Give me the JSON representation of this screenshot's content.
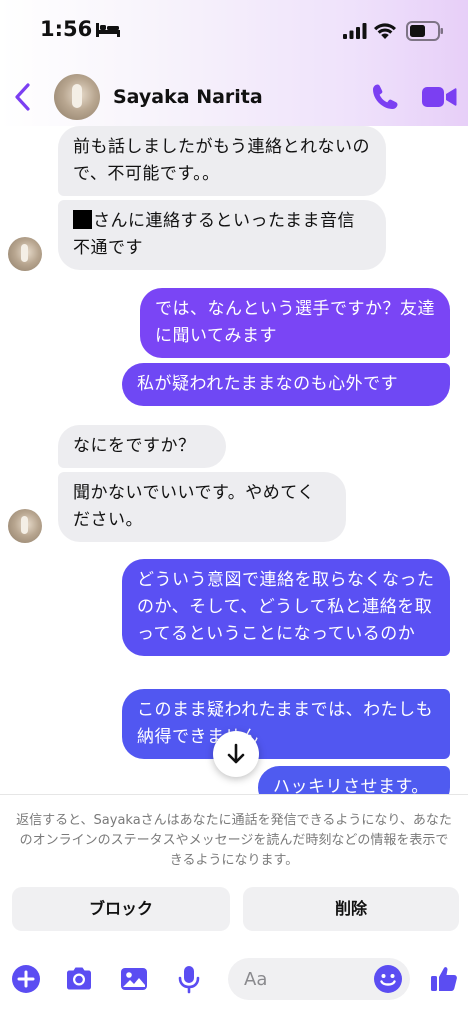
{
  "status_bar": {
    "time": "1:56"
  },
  "header": {
    "contact_name": "Sayaka Narita"
  },
  "messages": [
    {
      "side": "in",
      "text": "前も話しましたがもう連絡とれないので、不可能です。。"
    },
    {
      "side": "in",
      "text_after_redaction": "さんに連絡するといったまま音信不通です"
    },
    {
      "side": "out",
      "text": "では、なんという選手ですか？友達に聞いてみます"
    },
    {
      "side": "out",
      "text": "私が疑われたままなのも心外です"
    },
    {
      "side": "in",
      "text": "なにをですか？"
    },
    {
      "side": "in",
      "text": "聞かないでいいです。やめてください。"
    },
    {
      "side": "out",
      "text": "どういう意図で連絡を取らなくなったのか、そして、どうして私と連絡を取ってるということになっているのか"
    },
    {
      "side": "out",
      "text": "このまま疑われたままでは、わたしも納得できません"
    },
    {
      "side": "out",
      "text": "ハッキリさせます。"
    }
  ],
  "notice": {
    "text": "返信すると、Sayakaさんはあなたに通話を発信できるようになり、あなたのオンラインのステータスやメッセージを読んだ時刻などの情報を表示できるようになります。",
    "block_label": "ブロック",
    "delete_label": "削除"
  },
  "composer": {
    "placeholder": "Aa"
  },
  "colors": {
    "accent": "#7b3ff2",
    "incoming_bubble": "#ededf0",
    "outgoing_top": "#7a45f5",
    "outgoing_bottom": "#4f5bf0"
  },
  "icons": [
    "bed-icon",
    "signal-icon",
    "wifi-icon",
    "battery-icon",
    "back-icon",
    "phone-icon",
    "video-icon",
    "arrow-down-icon",
    "plus-icon",
    "camera-icon",
    "image-icon",
    "microphone-icon",
    "emoji-icon",
    "thumbs-up-icon"
  ]
}
